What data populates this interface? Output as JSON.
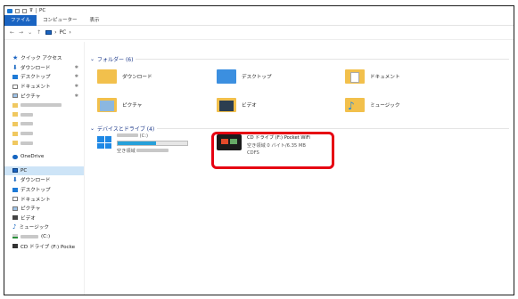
{
  "titlebar": {
    "title": "PC"
  },
  "ribbon": {
    "tabs": [
      "ファイル",
      "コンピューター",
      "表示"
    ]
  },
  "address": {
    "back": "←",
    "forward": "→",
    "dropdown": "⌄",
    "up": "↑",
    "path": "PC",
    "sep": "›"
  },
  "nav": {
    "quick_access": "クイック アクセス",
    "quick_items": [
      "ダウンロード",
      "デスクトップ",
      "ドキュメント",
      "ピクチャ"
    ],
    "onedrive": "OneDrive",
    "pc": "PC",
    "pc_items": [
      "ダウンロード",
      "デスクトップ",
      "ドキュメント",
      "ピクチャ",
      "ビデオ",
      "ミュージック"
    ],
    "local_drive_suffix": "(C:)",
    "cd_drive": "CD ドライブ (F:) Pocke"
  },
  "folders": {
    "header": "フォルダー (6)",
    "items": [
      "ダウンロード",
      "デスクトップ",
      "ドキュメント",
      "ピクチャ",
      "ビデオ",
      "ミュージック"
    ]
  },
  "devices": {
    "header": "デバイスとドライブ (4)",
    "local": {
      "label": "(C:)",
      "free_prefix": "空き領域",
      "used_fraction": 0.55
    },
    "cd": {
      "name": "CD ドライブ (F:) Pocket WiFi",
      "free": "空き領域 0 バイト/6.35 MB",
      "fs": "CDFS"
    }
  },
  "colors": {
    "accent": "#1a64c2",
    "highlight": "#e60012",
    "bar": "#26a0da"
  }
}
